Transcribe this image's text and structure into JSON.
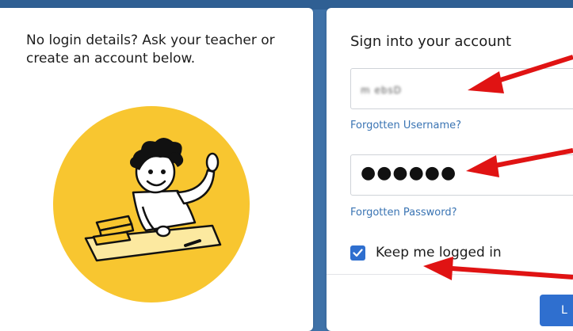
{
  "left_panel": {
    "message": "No login details? Ask your teacher or create an account below."
  },
  "signin": {
    "title": "Sign into your account",
    "username_value": "m ebsD",
    "password_value": "●●●●●●",
    "forgot_username": "Forgotten Username?",
    "forgot_password": "Forgotten Password?",
    "keep_logged_in": "Keep me logged in",
    "keep_logged_in_checked": true,
    "login_button": "L"
  },
  "colors": {
    "background": "#3f72a8",
    "accent": "#2f6fcf",
    "link": "#3a74b3",
    "illustration": "#f8c630",
    "annotation_arrow": "#e01313"
  },
  "icons": {
    "checkbox": "checkmark-icon",
    "illustration": "student-raising-hand-illustration",
    "annotations": "red-arrow-icon"
  }
}
